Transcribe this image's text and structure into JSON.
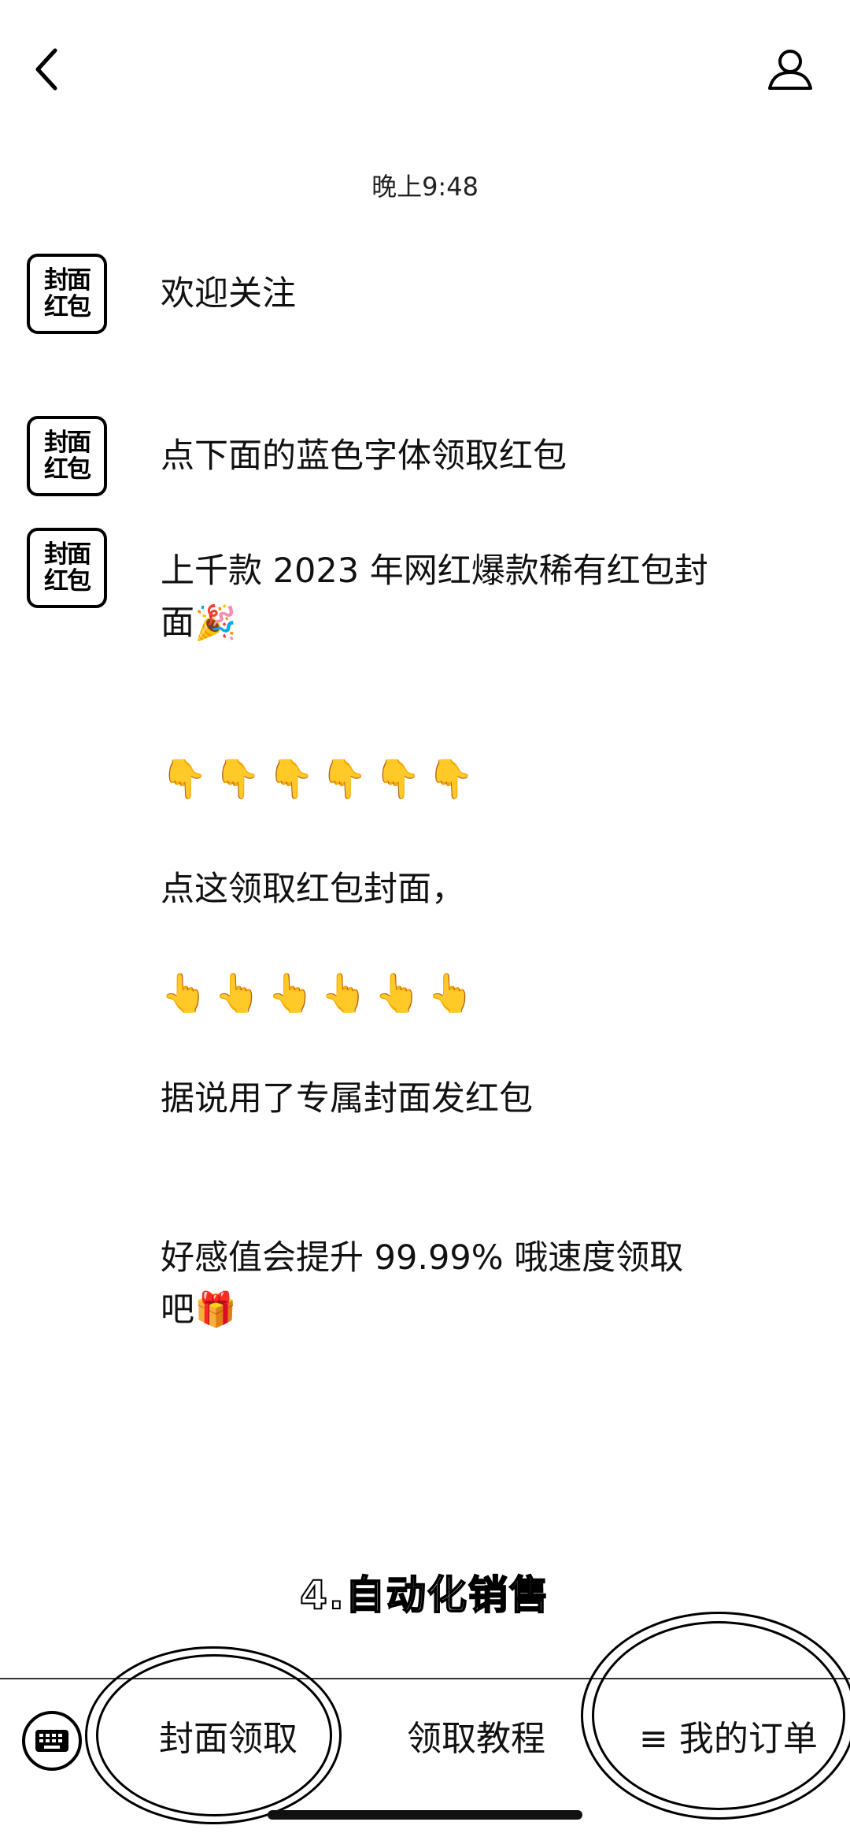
{
  "header": {
    "back_icon": "chevron-left-icon",
    "profile_icon": "person-icon"
  },
  "timestamp": "晚上9:48",
  "avatar": {
    "line1": "封面",
    "line2": "红包"
  },
  "messages": [
    {
      "text": "欢迎关注"
    },
    {
      "text": "点下面的蓝色字体领取红包"
    },
    {
      "text": "上千款 2023 年网红爆款稀有红包封面🎉"
    },
    {
      "text": "👇👇👇👇👇👇"
    },
    {
      "text": "点这领取红包封面，"
    },
    {
      "text": "👆👆👆👆👆👆"
    },
    {
      "text": "据说用了专属封面发红包"
    },
    {
      "text": "好感值会提升 99.99% 哦速度领取吧🎁"
    }
  ],
  "caption": "4.自动化销售",
  "bottom_menu": {
    "keyboard_icon": "keyboard-icon",
    "items": [
      {
        "label": "封面领取"
      },
      {
        "label": "领取教程"
      },
      {
        "label": "≡ 我的订单"
      }
    ]
  }
}
